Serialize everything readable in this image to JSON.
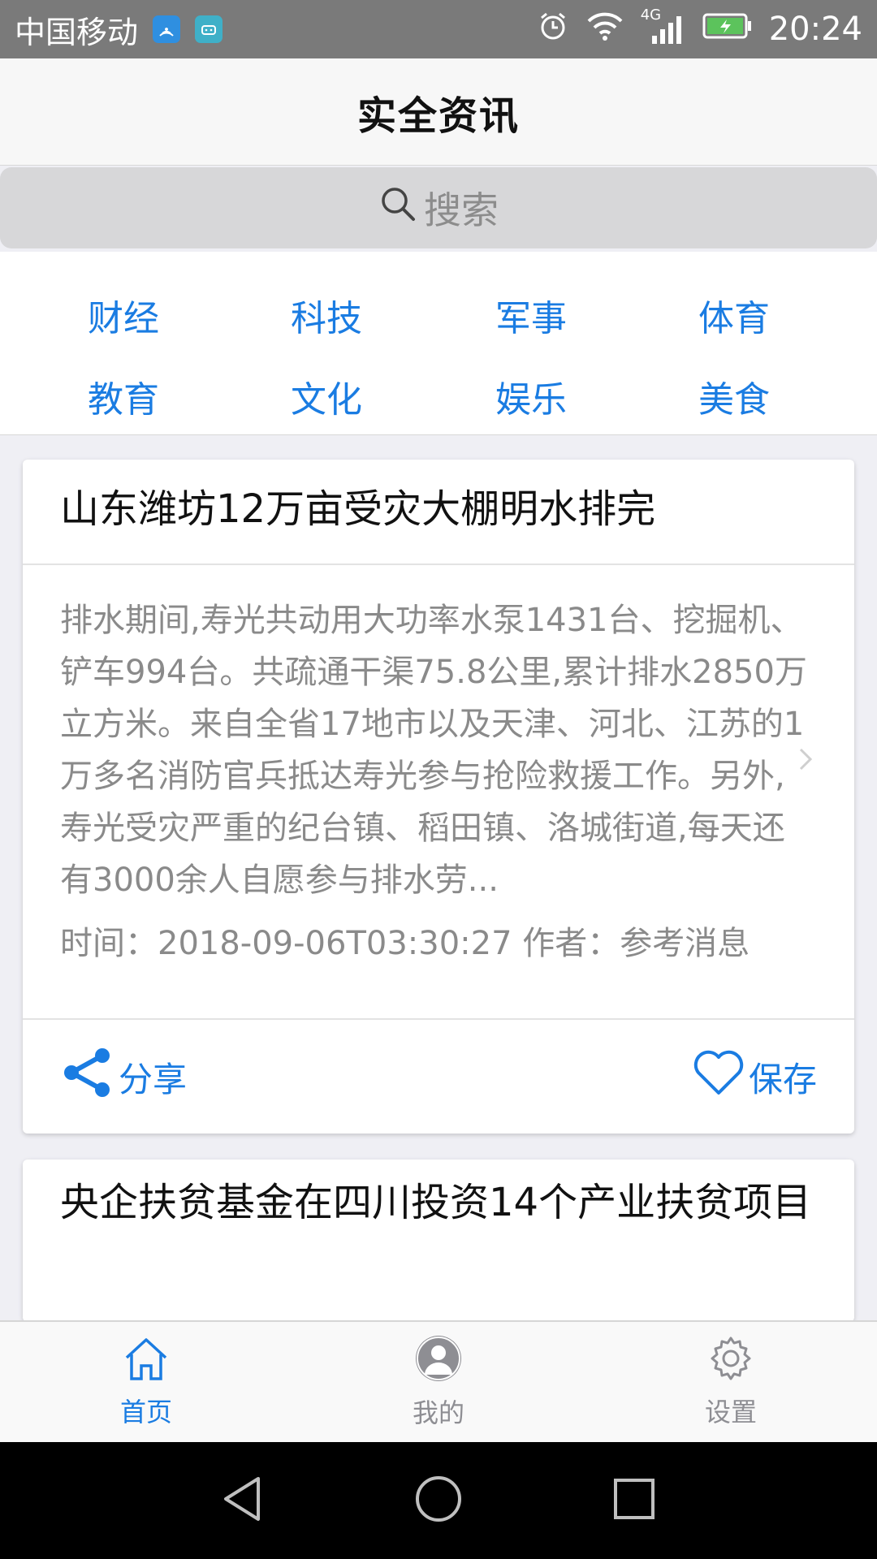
{
  "status_bar": {
    "carrier": "中国移动",
    "network": "4G",
    "time": "20:24",
    "icons": [
      "wifi-hotspot-icon",
      "android-icon",
      "alarm-icon",
      "wifi-icon",
      "signal-icon",
      "battery-icon"
    ],
    "badge_colors": {
      "hotspot": "#2f8fe0",
      "android": "#3fb0c8"
    }
  },
  "header": {
    "title": "实全资讯"
  },
  "search": {
    "placeholder": "搜索",
    "icon": "search-icon"
  },
  "categories": [
    "财经",
    "科技",
    "军事",
    "体育",
    "教育",
    "文化",
    "娱乐",
    "美食"
  ],
  "articles": [
    {
      "title": "山东潍坊12万亩受灾大棚明水排完",
      "summary": "排水期间,寿光共动用大功率水泵1431台、挖掘机、铲车994台。共疏通干渠75.8公里,累计排水2850万立方米。来自全省17地市以及天津、河北、江苏的1万多名消防官兵抵达寿光参与抢险救援工作。另外,寿光受灾严重的纪台镇、稻田镇、洛城街道,每天还有3000余人自愿参与排水劳...",
      "meta": "时间：2018-09-06T03:30:27 作者：参考消息",
      "share_label": "分享",
      "save_label": "保存"
    },
    {
      "title": "央企扶贫基金在四川投资14个产业扶贫项目"
    }
  ],
  "tab_bar": [
    {
      "label": "首页",
      "icon": "home-icon",
      "active": true
    },
    {
      "label": "我的",
      "icon": "user-avatar-icon",
      "active": false
    },
    {
      "label": "设置",
      "icon": "gear-icon",
      "active": false
    }
  ],
  "system_nav": [
    "back-icon",
    "home-circle-icon",
    "recents-icon"
  ],
  "colors": {
    "accent": "#1a7ce2",
    "text_gray": "#8a8a8a",
    "status_bar": "#7a7a7a"
  }
}
